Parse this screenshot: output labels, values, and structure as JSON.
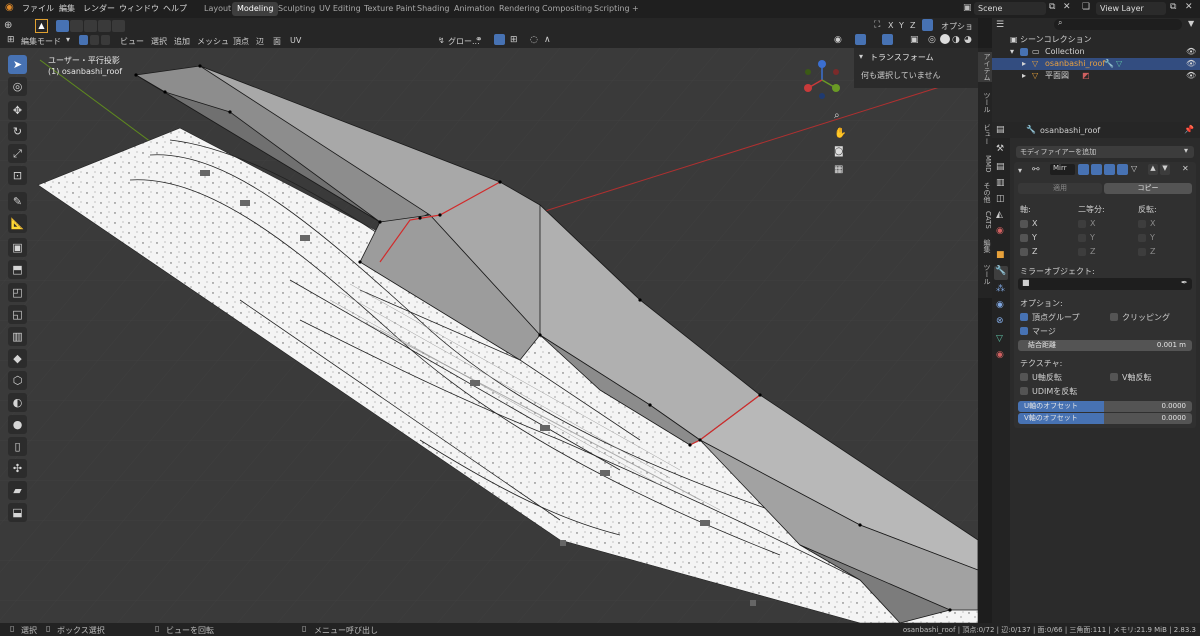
{
  "topbar": {
    "menus": [
      "ファイル",
      "編集",
      "レンダー",
      "ウィンドウ",
      "ヘルプ"
    ],
    "workspaces": [
      "Layout",
      "Modeling",
      "Sculpting",
      "UV Editing",
      "Texture Paint",
      "Shading",
      "Animation",
      "Rendering",
      "Compositing",
      "Scripting",
      "+"
    ],
    "active_workspace": "Modeling",
    "scene": "Scene",
    "view_layer": "View Layer"
  },
  "viewport_header": {
    "mode": "編集モード",
    "menus": [
      "ビュー",
      "選択",
      "追加",
      "メッシュ",
      "頂点",
      "辺",
      "面",
      "UV"
    ],
    "transform": "グロー...",
    "axes": [
      "X",
      "Y",
      "Z"
    ],
    "options": "オプション"
  },
  "viewport": {
    "view_name": "ユーザー・平行投影",
    "object_label": "(1) osanbashi_roof"
  },
  "npanel": {
    "title": "トランスフォーム",
    "message": "何も選択していません",
    "tabs": [
      "アイテム",
      "ツール",
      "ビュー",
      "MMD",
      "その他",
      "CATS",
      "編集",
      "ツール"
    ]
  },
  "outliner": {
    "scene_collection": "シーンコレクション",
    "collection": "Collection",
    "items": [
      {
        "name": "osanbashi_roof",
        "selected": true
      },
      {
        "name": "平面図",
        "selected": false
      }
    ]
  },
  "properties": {
    "object_name": "osanbashi_roof",
    "add_modifier": "モディファイアーを追加",
    "modifier_name": "Mirr",
    "apply": "適用",
    "copy": "コピー",
    "axis_label": "軸:",
    "bisect_label": "二等分:",
    "flip_label": "反転:",
    "axes": [
      "X",
      "Y",
      "Z"
    ],
    "mirror_object_label": "ミラーオブジェクト:",
    "options_label": "オプション:",
    "vertex_groups": "頂点グループ",
    "clipping": "クリッピング",
    "merge": "マージ",
    "merge_distance_label": "結合距離",
    "merge_distance_value": "0.001 m",
    "texture_label": "テクスチャ:",
    "u_flip": "U軸反転",
    "v_flip": "V軸反転",
    "udim_flip": "UDIMを反転",
    "u_offset_label": "U軸のオフセット",
    "u_offset_value": "0.0000",
    "v_offset_label": "V軸のオフセット",
    "v_offset_value": "0.0000"
  },
  "statusbar": {
    "select": "選択",
    "box_select": "ボックス選択",
    "rotate_view": "ビューを回転",
    "call_menu": "メニュー呼び出し",
    "stats": "osanbashi_roof | 頂点:0/72 | 辺:0/137 | 面:0/66 | 三角面:111 | メモリ:21.9 MiB | 2.83.3"
  },
  "colors": {
    "accent": "#4772b3",
    "selected_row": "#334d80",
    "seam_edge": "#d12b2b",
    "x_axis": "#c83a3a",
    "y_axis": "#6a9a25",
    "roof": "#9a9a9a"
  }
}
